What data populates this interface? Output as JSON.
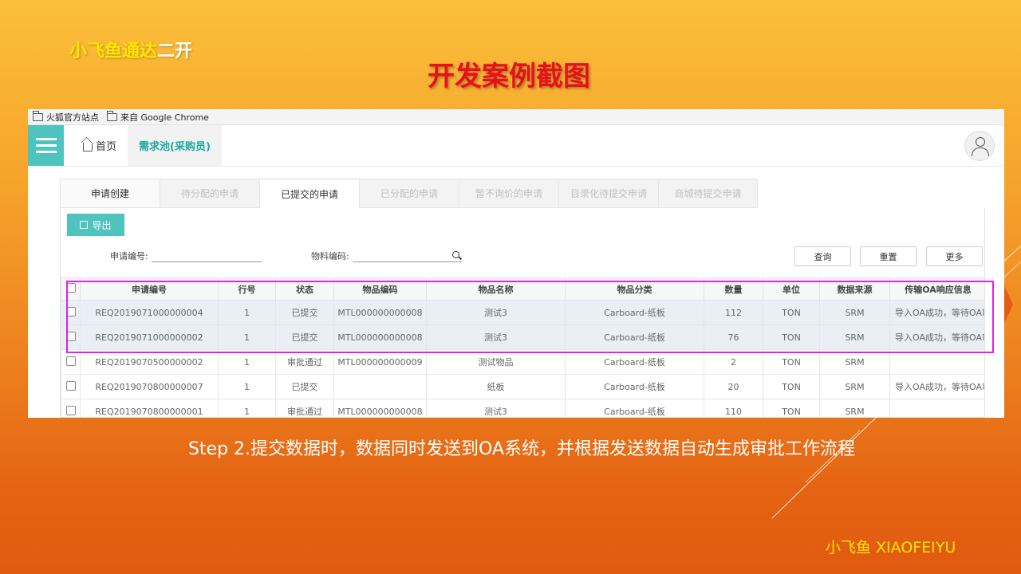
{
  "slide": {
    "brand_yellow": "小飞鱼通达",
    "brand_white": "二开",
    "title": "开发案例截图",
    "caption": "Step 2.提交数据时，数据同时发送到OA系统，并根据发送数据自动生成审批工作流程",
    "footer": "小飞鱼  XIAOFEIYU",
    "colors": {
      "accent": "#4fc3bd",
      "title_red": "#e8101a",
      "brand_yellow": "#ffe600",
      "highlight": "#e020f0"
    }
  },
  "browser": {
    "bookmarks": [
      "火狐官方站点",
      "来自 Google Chrome"
    ]
  },
  "app": {
    "menu_icon": "hamburger-icon",
    "nav": {
      "home": "首页",
      "active": "需求池(采购员)"
    },
    "user_icon": "user-icon",
    "tabs": [
      "申请创建",
      "待分配的申请",
      "已提交的申请",
      "已分配的申请",
      "暂不询价的申请",
      "目录化待提交申请",
      "商城待提交申请"
    ],
    "export_label": "导出",
    "filters": {
      "req_no_label": "申请编号:",
      "material_label": "物料编码:"
    },
    "buttons": {
      "query": "查询",
      "reset": "重置",
      "more": "更多"
    },
    "table": {
      "headers": [
        "申请编号",
        "行号",
        "状态",
        "物品编码",
        "物品名称",
        "物品分类",
        "数量",
        "单位",
        "数据来源",
        "传输OA响应信息"
      ],
      "rows": [
        [
          "REQ2019071000000004",
          "1",
          "已提交",
          "MTL000000000008",
          "测试3",
          "Carboard-纸板",
          "112",
          "TON",
          "SRM",
          "导入OA成功，等待OA审"
        ],
        [
          "REQ2019071000000002",
          "1",
          "已提交",
          "MTL000000000008",
          "测试3",
          "Carboard-纸板",
          "76",
          "TON",
          "SRM",
          "导入OA成功，等待OA审"
        ],
        [
          "REQ2019070500000002",
          "1",
          "审批通过",
          "MTL000000000009",
          "测试物品",
          "Carboard-纸板",
          "2",
          "TON",
          "SRM",
          ""
        ],
        [
          "REQ2019070800000007",
          "1",
          "已提交",
          "",
          "纸板",
          "Carboard-纸板",
          "20",
          "TON",
          "SRM",
          "导入OA成功，等待OA审"
        ],
        [
          "REQ2019070800000001",
          "1",
          "审批通过",
          "MTL000000000008",
          "测试3",
          "Carboard-纸板",
          "110",
          "TON",
          "SRM",
          ""
        ]
      ]
    }
  }
}
